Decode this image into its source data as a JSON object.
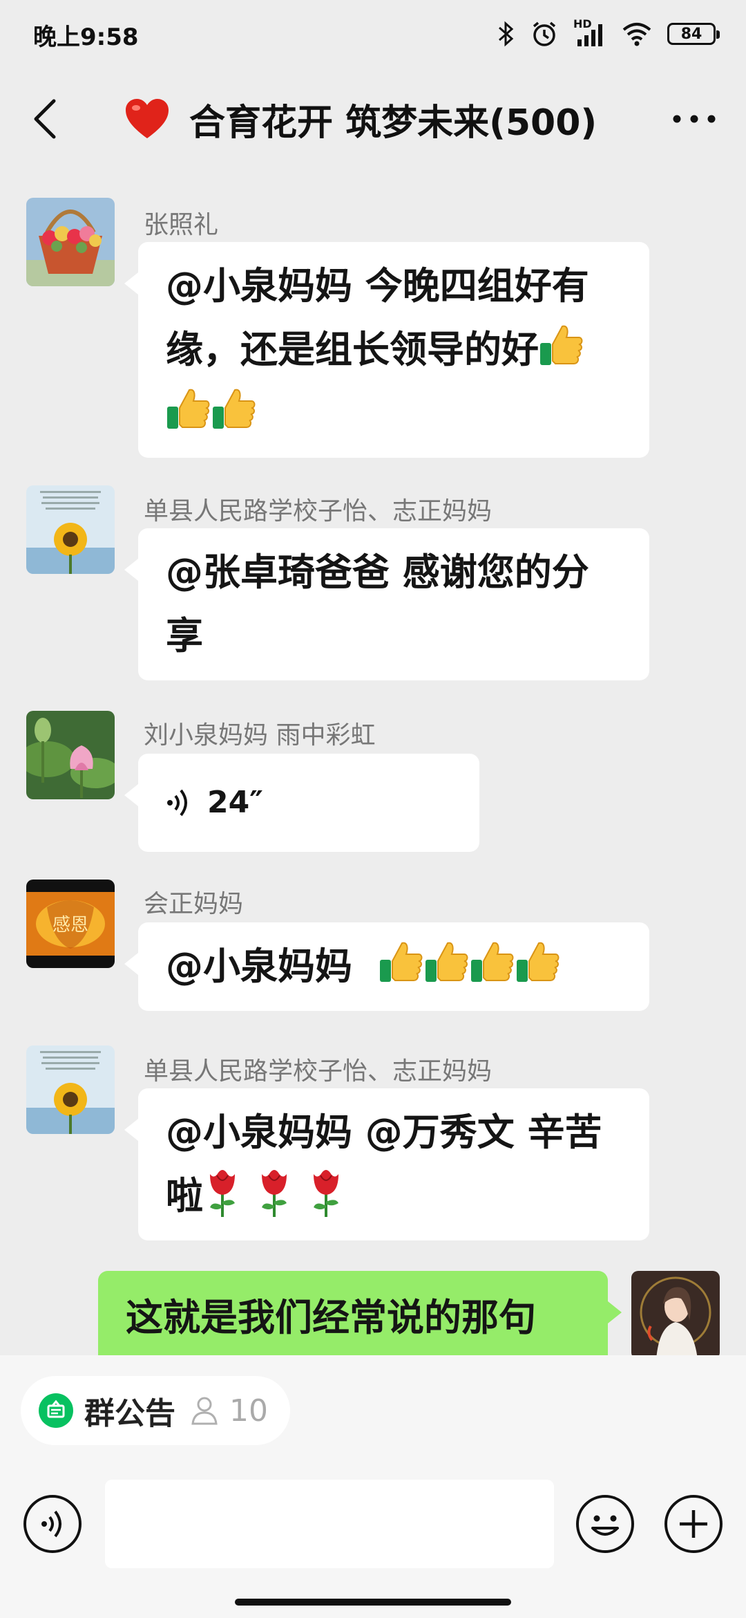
{
  "status_bar": {
    "time": "晚上9:58",
    "network_label": "HD",
    "battery": "84"
  },
  "header": {
    "title": "合育花开 筑梦未来(500)",
    "heart_icon": "red-heart-icon"
  },
  "messages": [
    {
      "sender": "张照礼",
      "text": "@小泉妈妈  今晚四组好有缘，还是组长领导的好",
      "emoji": "thumbs-up x3"
    },
    {
      "sender": "单县人民路学校子怡、志正妈妈",
      "text": "@张卓琦爸爸  感谢您的分享"
    },
    {
      "sender": "刘小泉妈妈  雨中彩虹",
      "voice_duration": "24″"
    },
    {
      "sender": "会正妈妈",
      "text": "@小泉妈妈",
      "emoji": "thumbs-up x4"
    },
    {
      "sender": "单县人民路学校子怡、志正妈妈",
      "text": "@小泉妈妈 @万秀文  辛苦啦",
      "emoji": "rose x3"
    },
    {
      "sender": "me",
      "text": "这就是我们经常说的那句"
    }
  ],
  "bottom": {
    "announcement_label": "群公告",
    "announcement_count": "10"
  },
  "colors": {
    "background": "#ededed",
    "bubble_in": "#ffffff",
    "bubble_out": "#95ec69",
    "announce_icon": "#07c160"
  }
}
